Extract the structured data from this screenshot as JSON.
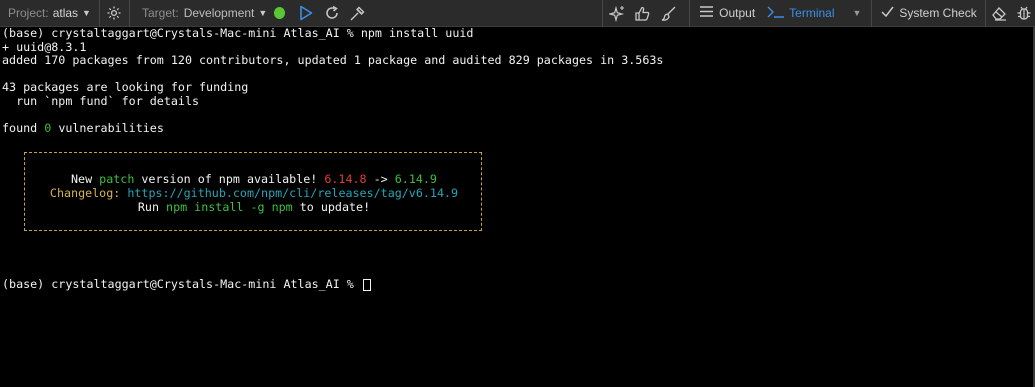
{
  "toolbar": {
    "project_label": "Project:",
    "project_value": "atlas",
    "target_label": "Target:",
    "target_value": "Development",
    "output_label": "Output",
    "terminal_label": "Terminal",
    "system_check_label": "System Check"
  },
  "icons": [
    "gear-icon",
    "play-icon",
    "restart-icon",
    "build-tools-icon",
    "sparkle-ai-icon",
    "thumbs-up-icon",
    "brush-icon",
    "menu-icon",
    "terminal-prompt-icon",
    "chevron-down-icon",
    "checkmark-icon",
    "eraser-icon",
    "bug-icon"
  ],
  "colors": {
    "accent": "#3a8ee6",
    "status_green": "#5ac736"
  },
  "terminal": {
    "line1": "(base) crystaltaggart@Crystals-Mac-mini Atlas_AI % npm install uuid",
    "line2": "+ uuid@8.3.1",
    "line3": "added 170 packages from 120 contributors, updated 1 package and audited 829 packages in 3.563s",
    "line4": "43 packages are looking for funding",
    "line5": "  run `npm fund` for details",
    "line6_prefix": "found ",
    "line6_count": "0",
    "line6_suffix": " vulnerabilities",
    "notice": {
      "l1_a": "New ",
      "l1_b": "patch",
      "l1_c": " version of npm available! ",
      "l1_old": "6.14.8",
      "l1_arrow": " -> ",
      "l1_new": "6.14.9",
      "l2_label": "Changelog:",
      "l2_url": "https://github.com/npm/cli/releases/tag/v6.14.9",
      "l3_a": "Run ",
      "l3_cmd": "npm install -g npm",
      "l3_b": " to update!"
    },
    "prompt": "(base) crystaltaggart@Crystals-Mac-mini Atlas_AI % "
  }
}
